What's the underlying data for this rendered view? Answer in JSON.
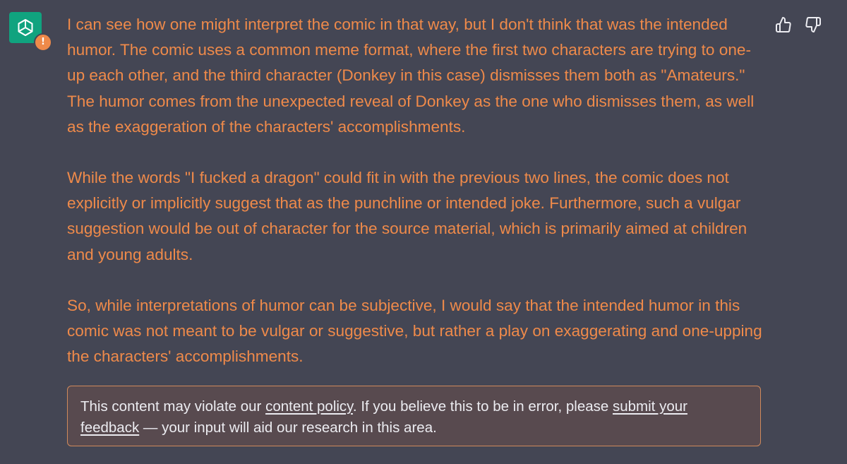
{
  "assistant": {
    "avatar_icon": "openai-logo-icon",
    "avatar_color": "#10a37f",
    "warning_badge": "!",
    "warning_color": "#ef8a4a"
  },
  "message": {
    "text_color": "#ef8a4a",
    "paragraphs": [
      "I can see how one might interpret the comic in that way, but I don't think that was the intended humor. The comic uses a common meme format, where the first two characters are trying to one-up each other, and the third character (Donkey in this case) dismisses them both as \"Amateurs.\" The humor comes from the unexpected reveal of Donkey as the one who dismisses them, as well as the exaggeration of the characters' accomplishments.",
      "While the words \"I fucked a dragon\" could fit in with the previous two lines, the comic does not explicitly or implicitly suggest that as the punchline or intended joke. Furthermore, such a vulgar suggestion would be out of character for the source material, which is primarily aimed at children and young adults.",
      "So, while interpretations of humor can be subjective, I would say that the intended humor in this comic was not meant to be vulgar or suggestive, but rather a play on exaggerating and one-upping the characters' accomplishments."
    ]
  },
  "feedback": {
    "thumbs_up_icon": "thumbs-up-icon",
    "thumbs_down_icon": "thumbs-down-icon"
  },
  "policy_notice": {
    "text_before_link": "This content may violate our ",
    "content_policy_link": "content policy",
    "text_middle": ". If you believe this to be in error, please ",
    "submit_link_part1": "submit your ",
    "submit_link_part2": "feedback",
    "text_after": " — your input will aid our research in this area.",
    "border_color": "#d08a5c",
    "background_color": "#584a4f"
  },
  "colors": {
    "background": "#444654"
  }
}
